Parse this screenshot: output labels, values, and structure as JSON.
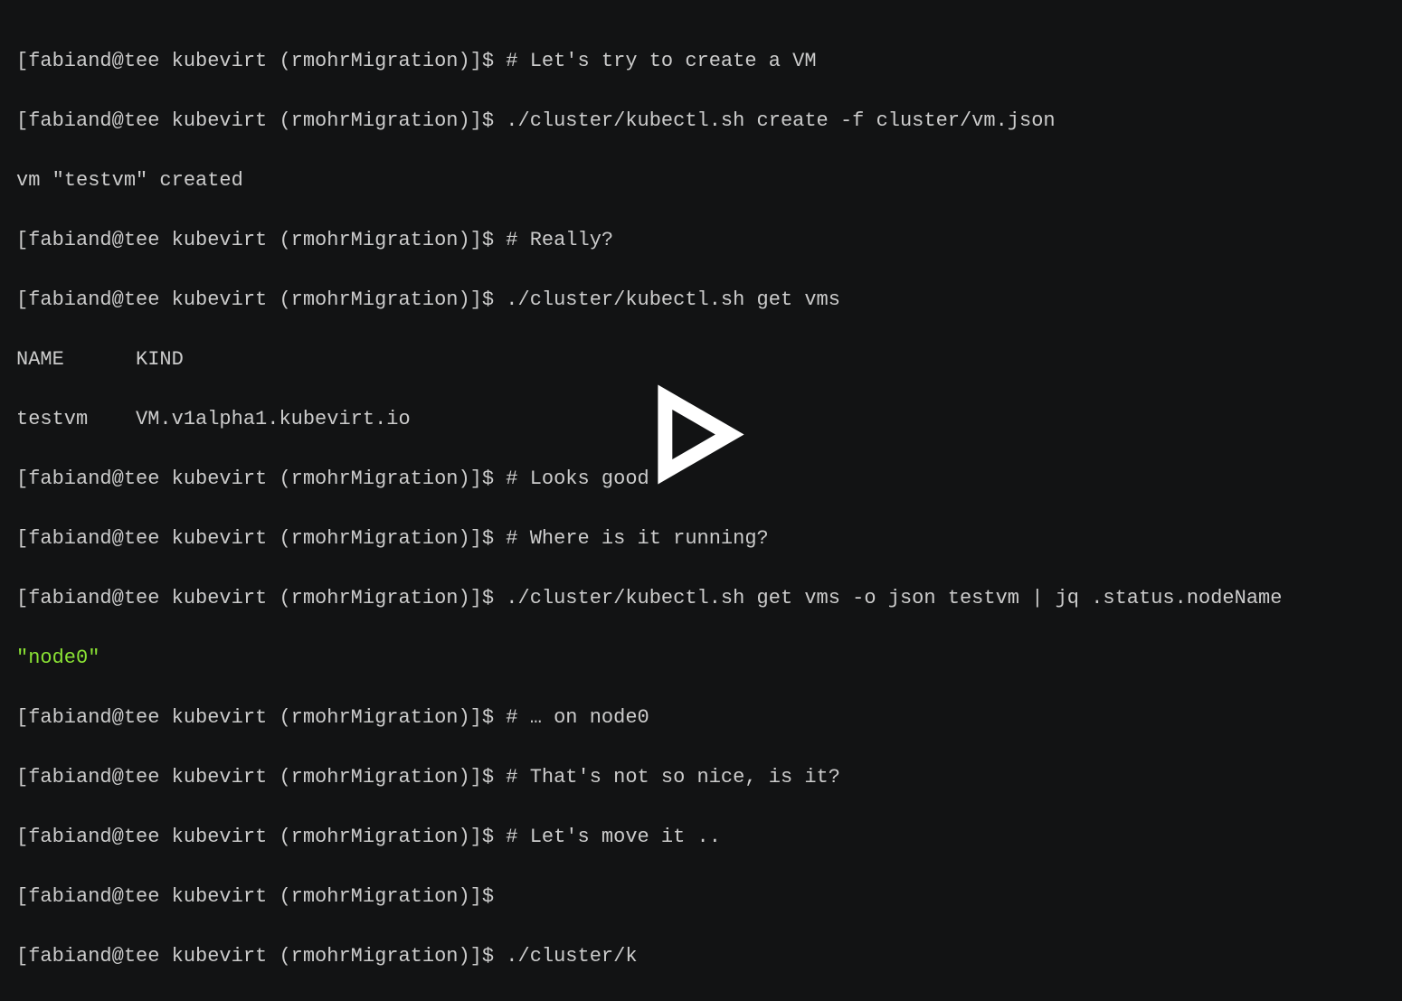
{
  "prompt": "[fabiand@tee kubevirt (rmohrMigration)]$ ",
  "lines": {
    "l1_cmd": "# Let's try to create a VM",
    "l2_cmd": "./cluster/kubectl.sh create -f cluster/vm.json",
    "l3_out": "vm \"testvm\" created",
    "l4_cmd": "# Really?",
    "l5_cmd": "./cluster/kubectl.sh get vms",
    "l6_out": "NAME      KIND",
    "l7_out": "testvm    VM.v1alpha1.kubevirt.io",
    "l8_cmd": "# Looks good",
    "l9_cmd": "# Where is it running?",
    "l10_cmd": "./cluster/kubectl.sh get vms -o json testvm | jq .status.nodeName",
    "l11_out": "\"node0\"",
    "l12_cmd": "# … on node0",
    "l13_cmd": "# That's not so nice, is it?",
    "l14_cmd": "# Let's move it ..",
    "l15_cmd": "",
    "l16_cmd": "./cluster/k"
  }
}
